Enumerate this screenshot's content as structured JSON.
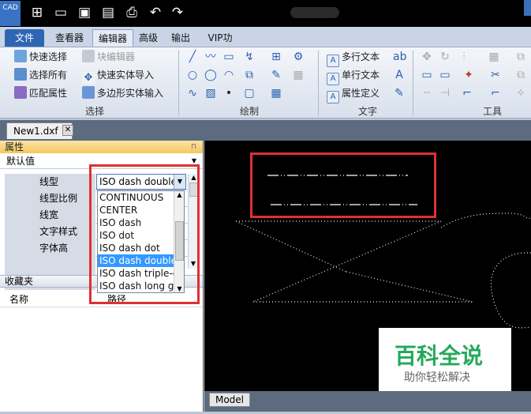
{
  "titlebar": {
    "logo": "CAD"
  },
  "tabs": [
    "文件",
    "查看器",
    "编辑器",
    "高级",
    "输出",
    "VIP功能"
  ],
  "ribbon": {
    "select": {
      "label": "选择",
      "items": [
        "快速选择",
        "选择所有",
        "匹配属性",
        "块编辑器",
        "快速实体导入",
        "多边形实体输入"
      ]
    },
    "draw": {
      "label": "绘制"
    },
    "text": {
      "label": "文字",
      "items": [
        "多行文本",
        "单行文本",
        "属性定义"
      ]
    },
    "tools": {
      "label": "工具"
    }
  },
  "doctab": {
    "name": "New1.dxf",
    "close": "✕"
  },
  "properties": {
    "header": "属性",
    "pin": "⊓",
    "preset": "默认值",
    "rows": [
      "线型",
      "线型比例",
      "线宽",
      "文字样式",
      "字体高"
    ],
    "linetype_value": "ISO dash double-",
    "options": [
      "CONTINUOUS",
      "CENTER",
      "ISO dash",
      "ISO dot",
      "ISO dash dot",
      "ISO dash double-",
      "ISO dash triple-dot",
      "ISO dash long gap"
    ],
    "selected_index": 5
  },
  "favorites": {
    "header": "收藏夹",
    "col_name": "名称",
    "col_path": "路径"
  },
  "canvas": {
    "model_tab": "Model"
  },
  "watermark": {
    "line1": "百科全说",
    "line2": "助你轻松解决"
  }
}
